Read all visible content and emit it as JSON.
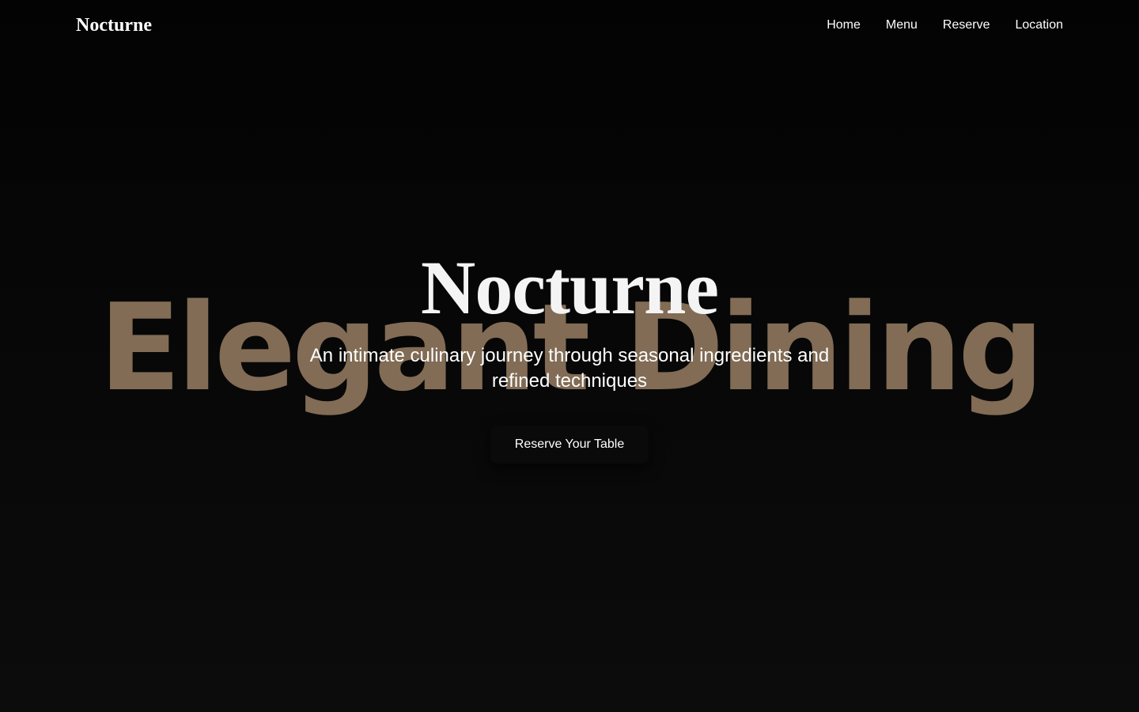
{
  "header": {
    "brand": "Nocturne",
    "nav": [
      {
        "label": "Home"
      },
      {
        "label": "Menu"
      },
      {
        "label": "Reserve"
      },
      {
        "label": "Location"
      }
    ]
  },
  "hero": {
    "backdrop_text": "Elegant Dining",
    "title": "Nocturne",
    "subtitle": "An intimate culinary journey through seasonal ingredients and refined techniques",
    "cta_label": "Reserve Your Table"
  },
  "colors": {
    "background": "#050505",
    "backdrop_text": "#826c55",
    "text": "#ffffff"
  }
}
